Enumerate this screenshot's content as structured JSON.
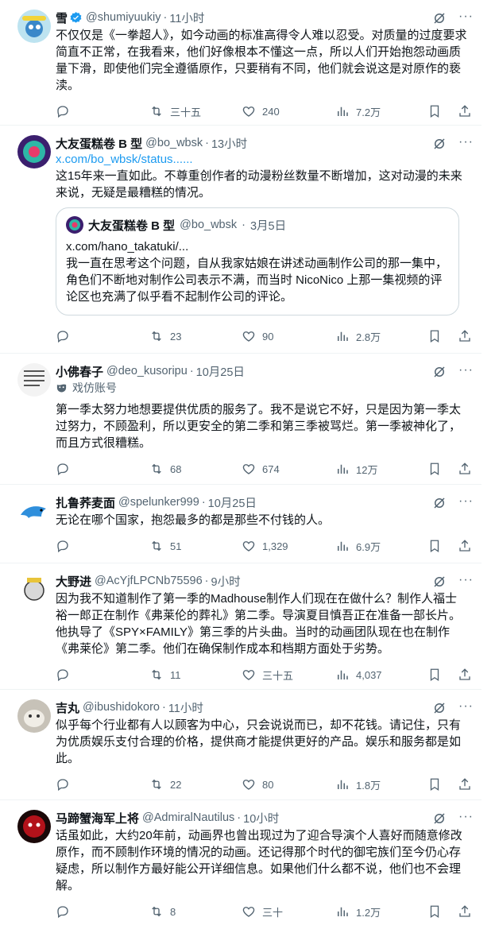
{
  "tweets": [
    {
      "name": "雪",
      "handle": "@shumiyuukiy",
      "time": "11小时",
      "verified": true,
      "text": "不仅仅是《一拳超人》，如今动画的标准高得令人难以忍受。对质量的过度要求简直不正常，在我看来，他们好像根本不懂这一点，所以人们开始抱怨动画质量下滑，即使他们完全遵循原作，只要稍有不同，他们就会说这是对原作的亵渎。",
      "replies": "",
      "retweets": "三十五",
      "likes": "240",
      "views": "7.2万"
    },
    {
      "name": "大友蛋糕卷 B 型",
      "handle": "@bo_wbsk",
      "time": "13小时",
      "link": "x.com/bo_wbsk/status......",
      "text": "这15年来一直如此。不尊重创作者的动漫粉丝数量不断增加，这对动漫的未来来说，无疑是最糟糕的情况。",
      "quote": {
        "name": "大友蛋糕卷 B 型",
        "handle": "@bo_wbsk",
        "time": "3月5日",
        "link": "x.com/hano_takatuki/...",
        "text": "我一直在思考这个问题，自从我家姑娘在讲述动画制作公司的那一集中，角色们不断地对制作公司表示不满，而当时 NicoNico 上那一集视频的评论区也充满了似乎看不起制作公司的评论。"
      },
      "replies": "",
      "retweets": "23",
      "likes": "90",
      "views": "2.8万"
    },
    {
      "name": "小佛春子",
      "handle": "@deo_kusoripu",
      "time": "10月25日",
      "parody": "戏仿账号",
      "text": "第一季太努力地想要提供优质的服务了。我不是说它不好，只是因为第一季太过努力，不顾盈利，所以更安全的第二季和第三季被骂烂。第一季被神化了，而且方式很糟糕。",
      "replies": "",
      "retweets": "68",
      "likes": "674",
      "views": "12万"
    },
    {
      "name": "扎鲁荞麦面",
      "handle": "@spelunker999",
      "time": "10月25日",
      "text": "无论在哪个国家，抱怨最多的都是那些不付钱的人。",
      "replies": "",
      "retweets": "51",
      "likes": "1,329",
      "views": "6.9万"
    },
    {
      "name": "大野进",
      "handle": "@AcYjfLPCNb75596",
      "time": "9小时",
      "text": "因为我不知道制作了第一季的Madhouse制作人们现在在做什么？制作人福士裕一郎正在制作《弗莱伦的葬礼》第二季。导演夏目慎吾正在准备一部长片。他执导了《SPY×FAMILY》第三季的片头曲。当时的动画团队现在也在制作《弗莱伦》第二季。他们在确保制作成本和档期方面处于劣势。",
      "replies": "",
      "retweets": "11",
      "likes": "三十五",
      "views": "4,037"
    },
    {
      "name": "吉丸",
      "handle": "@ibushidokoro",
      "time": "11小时",
      "text": "似乎每个行业都有人以顾客为中心，只会说说而已，却不花钱。请记住，只有为优质娱乐支付合理的价格，提供商才能提供更好的产品。娱乐和服务都是如此。",
      "replies": "",
      "retweets": "22",
      "likes": "80",
      "views": "1.8万"
    },
    {
      "name": "马蹄蟹海军上将",
      "handle": "@AdmiralNautilus",
      "time": "10小时",
      "text": "话虽如此，大约20年前，动画界也曾出现过为了迎合导演个人喜好而随意修改原作，而不顾制作环境的情况的动画。还记得那个时代的御宅族们至今仍心存疑虑，所以制作方最好能公开详细信息。如果他们什么都不说，他们也不会理解。",
      "replies": "",
      "retweets": "8",
      "likes": "三十",
      "views": "1.2万"
    }
  ],
  "colors": {
    "accent": "#1d9bf0",
    "muted": "#536471",
    "border": "#eff3f4"
  },
  "icons": [
    "verified-badge-icon",
    "grok-icon",
    "more-icon",
    "reply-icon",
    "retweet-icon",
    "like-icon",
    "views-icon",
    "bookmark-icon",
    "share-icon",
    "parody-mask-icon"
  ]
}
